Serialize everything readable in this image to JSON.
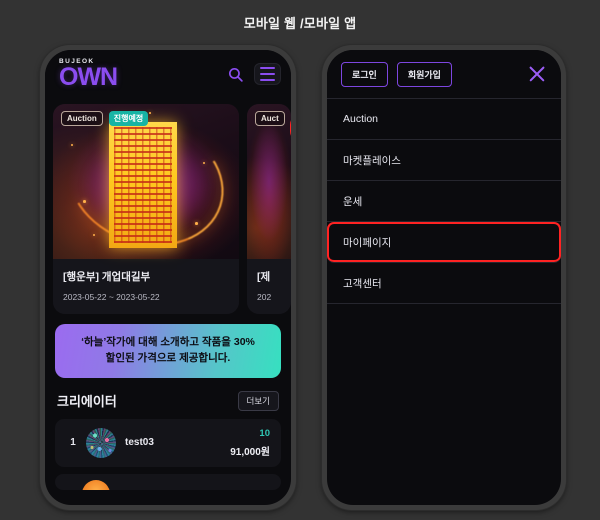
{
  "caption": "모바일 웹 /모바일 앱",
  "colors": {
    "page_background": "#333333",
    "screen_background": "#0b0b0e",
    "brand_purple": "#8b4df0",
    "accent_teal": "#2fc7b4",
    "highlight_red": "#ff2323",
    "badge_status": "#17b4a4"
  },
  "mobile_web": {
    "logo": {
      "sub": "BUJEOK",
      "main": "OWN"
    },
    "header_icons": [
      {
        "name": "search-icon",
        "label": "search"
      },
      {
        "name": "hamburger-menu-icon",
        "label": "menu",
        "highlighted": true
      }
    ],
    "carousel": {
      "cards": [
        {
          "badge_type": "Auction",
          "badge_status": "진행예정",
          "title": "[행운부] 개업대길부",
          "date": "2023-05-22 ~ 2023-05-22"
        },
        {
          "badge_type": "Auct",
          "badge_status": "",
          "title": "[제",
          "date": "202"
        }
      ]
    },
    "promo": {
      "line1": "‘하늘’작가에 대해 소개하고 작품을 30%",
      "line2": "할인된 가격으로 제공합니다."
    },
    "creator_section": {
      "title": "크리에이터",
      "more_label": "더보기",
      "rows": [
        {
          "rank": "1",
          "name": "test03",
          "count": "10",
          "price": "91,000원"
        }
      ]
    }
  },
  "mobile_app": {
    "auth": {
      "login": "로그인",
      "signup": "회원가입"
    },
    "close_label": "닫기",
    "menu_items": [
      {
        "label": "Auction",
        "highlighted": false
      },
      {
        "label": "마켓플레이스",
        "highlighted": false
      },
      {
        "label": "운세",
        "highlighted": false
      },
      {
        "label": "마이페이지",
        "highlighted": true
      },
      {
        "label": "고객센터",
        "highlighted": false
      }
    ]
  }
}
